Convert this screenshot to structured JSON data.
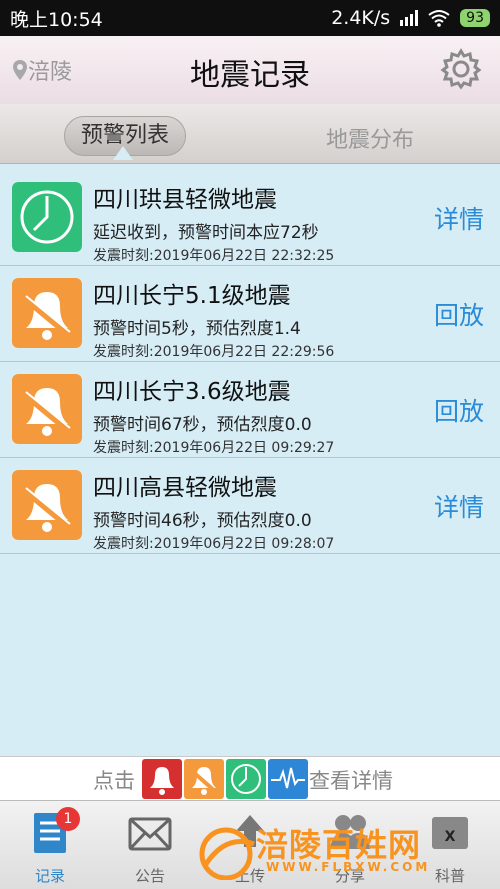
{
  "status_bar": {
    "time": "晚上10:54",
    "network_speed": "2.4K/s",
    "battery": "93"
  },
  "header": {
    "location": "涪陵",
    "title": "地震记录"
  },
  "tabs": [
    "预警列表",
    "地震分布"
  ],
  "records": [
    {
      "icon": "clock-icon",
      "badge_color": "#2fbf7a",
      "name": "四川珙县轻微地震",
      "desc": "延迟收到，预警时间本应72秒",
      "time": "发震时刻:2019年06月22日 22:32:25",
      "action": "详情"
    },
    {
      "icon": "bell-muted-icon",
      "badge_color": "#f59a3c",
      "name": "四川长宁5.1级地震",
      "desc": "预警时间5秒，预估烈度1.4",
      "time": "发震时刻:2019年06月22日 22:29:56",
      "action": "回放"
    },
    {
      "icon": "bell-muted-icon",
      "badge_color": "#f59a3c",
      "name": "四川长宁3.6级地震",
      "desc": "预警时间67秒，预估烈度0.0",
      "time": "发震时刻:2019年06月22日 09:29:27",
      "action": "回放"
    },
    {
      "icon": "bell-muted-icon",
      "badge_color": "#f59a3c",
      "name": "四川高县轻微地震",
      "desc": "预警时间46秒，预估烈度0.0",
      "time": "发震时刻:2019年06月22日 09:28:07",
      "action": "详情"
    }
  ],
  "hint": {
    "prefix": "点击",
    "suffix": "查看详情",
    "icons": [
      "bell-red-icon",
      "bell-orange-icon",
      "clock-green-icon",
      "wave-blue-icon"
    ]
  },
  "tabbar": {
    "items": [
      "记录",
      "公告",
      "上传",
      "分享",
      "科普"
    ],
    "notification_count": "1",
    "active": "记录"
  },
  "watermark": {
    "text": "涪陵百姓网",
    "url": "WWW.FLBXW.COM"
  },
  "colors": {
    "accent": "#2a8cd6",
    "green": "#2fbf7a",
    "orange": "#f59a3c",
    "red": "#d62f2f",
    "blue": "#2d86d6"
  }
}
